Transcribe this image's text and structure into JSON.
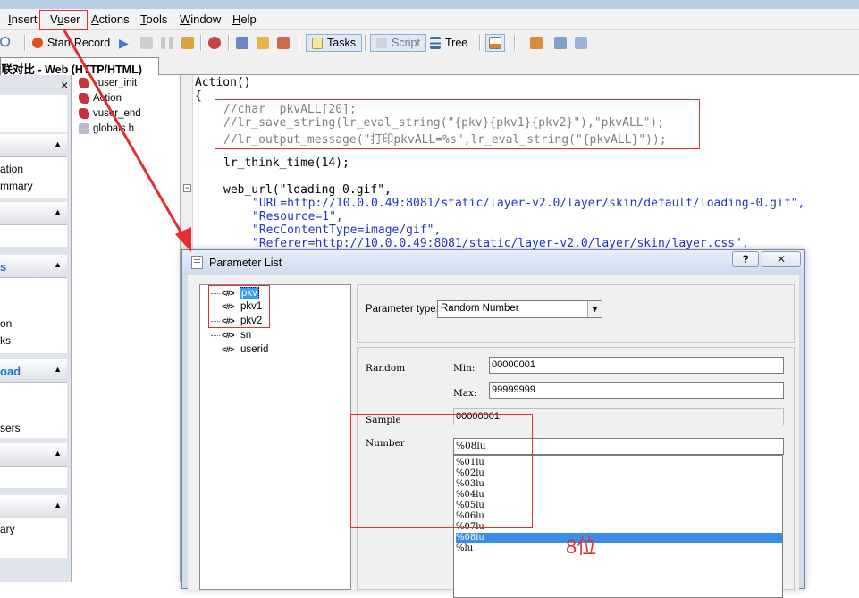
{
  "menu": {
    "items": [
      "Insert",
      "Vuser",
      "Actions",
      "Tools",
      "Window",
      "Help"
    ]
  },
  "toolbar": {
    "start_record": "Start Record",
    "tasks": "Tasks",
    "script": "Script",
    "tree": "Tree"
  },
  "doc_tab": {
    "title": "关联对比 - Web (HTTP/HTML)"
  },
  "left_pane": {
    "close_glyph": "×",
    "texts": [
      "ation",
      "mmary",
      "on",
      "ks",
      "sers",
      "ary"
    ],
    "blue_texts": [
      "s",
      "oad"
    ]
  },
  "script_tree": {
    "items": [
      "vuser_init",
      "Action",
      "vuser_end",
      "globals.h"
    ]
  },
  "editor": {
    "lines": [
      "Action()",
      "{",
      "//char  pkvALL[20];",
      "//lr_save_string(lr_eval_string(\"{pkv}{pkv1}{pkv2}\"),\"pkvALL\");",
      "//lr_output_message(\"打印pkvALL=%s\",lr_eval_string(\"{pkvALL}\"));",
      "lr_think_time(14);",
      "web_url(\"loading-0.gif\",",
      "\"URL=http://10.0.0.49:8081/static/layer-v2.0/layer/skin/default/loading-0.gif\",",
      "\"Resource=1\",",
      "\"RecContentType=image/gif\",",
      "\"Referer=http://10.0.0.49:8081/static/layer-v2.0/layer/skin/layer.css\","
    ]
  },
  "dialog": {
    "title": "Parameter List",
    "help": "?",
    "close": "✕",
    "params": [
      {
        "tag": "<#>",
        "name": "pkv",
        "selected": true
      },
      {
        "tag": "<#>",
        "name": "pkv1",
        "selected": false
      },
      {
        "tag": "<#>",
        "name": "pkv2",
        "selected": false
      },
      {
        "tag": "<#>",
        "name": "sn",
        "selected": false
      },
      {
        "tag": "<#>",
        "name": "userid",
        "selected": false
      }
    ],
    "param_type_label": "Parameter type:",
    "param_type_value": "Random Number",
    "random_label": "Random",
    "min_label": "Min:",
    "min_value": "00000001",
    "max_label": "Max:",
    "max_value": "99999999",
    "sample_label": "Sample",
    "sample_value": "00000001",
    "number_label": "Number",
    "number_value": "%08lu",
    "format_options": [
      "%01lu",
      "%02lu",
      "%03lu",
      "%04lu",
      "%05lu",
      "%06lu",
      "%07lu",
      "%08lu",
      "%lu"
    ],
    "format_selected": "%08lu"
  },
  "annotation": {
    "note": "8位",
    "color": "#e23030"
  }
}
